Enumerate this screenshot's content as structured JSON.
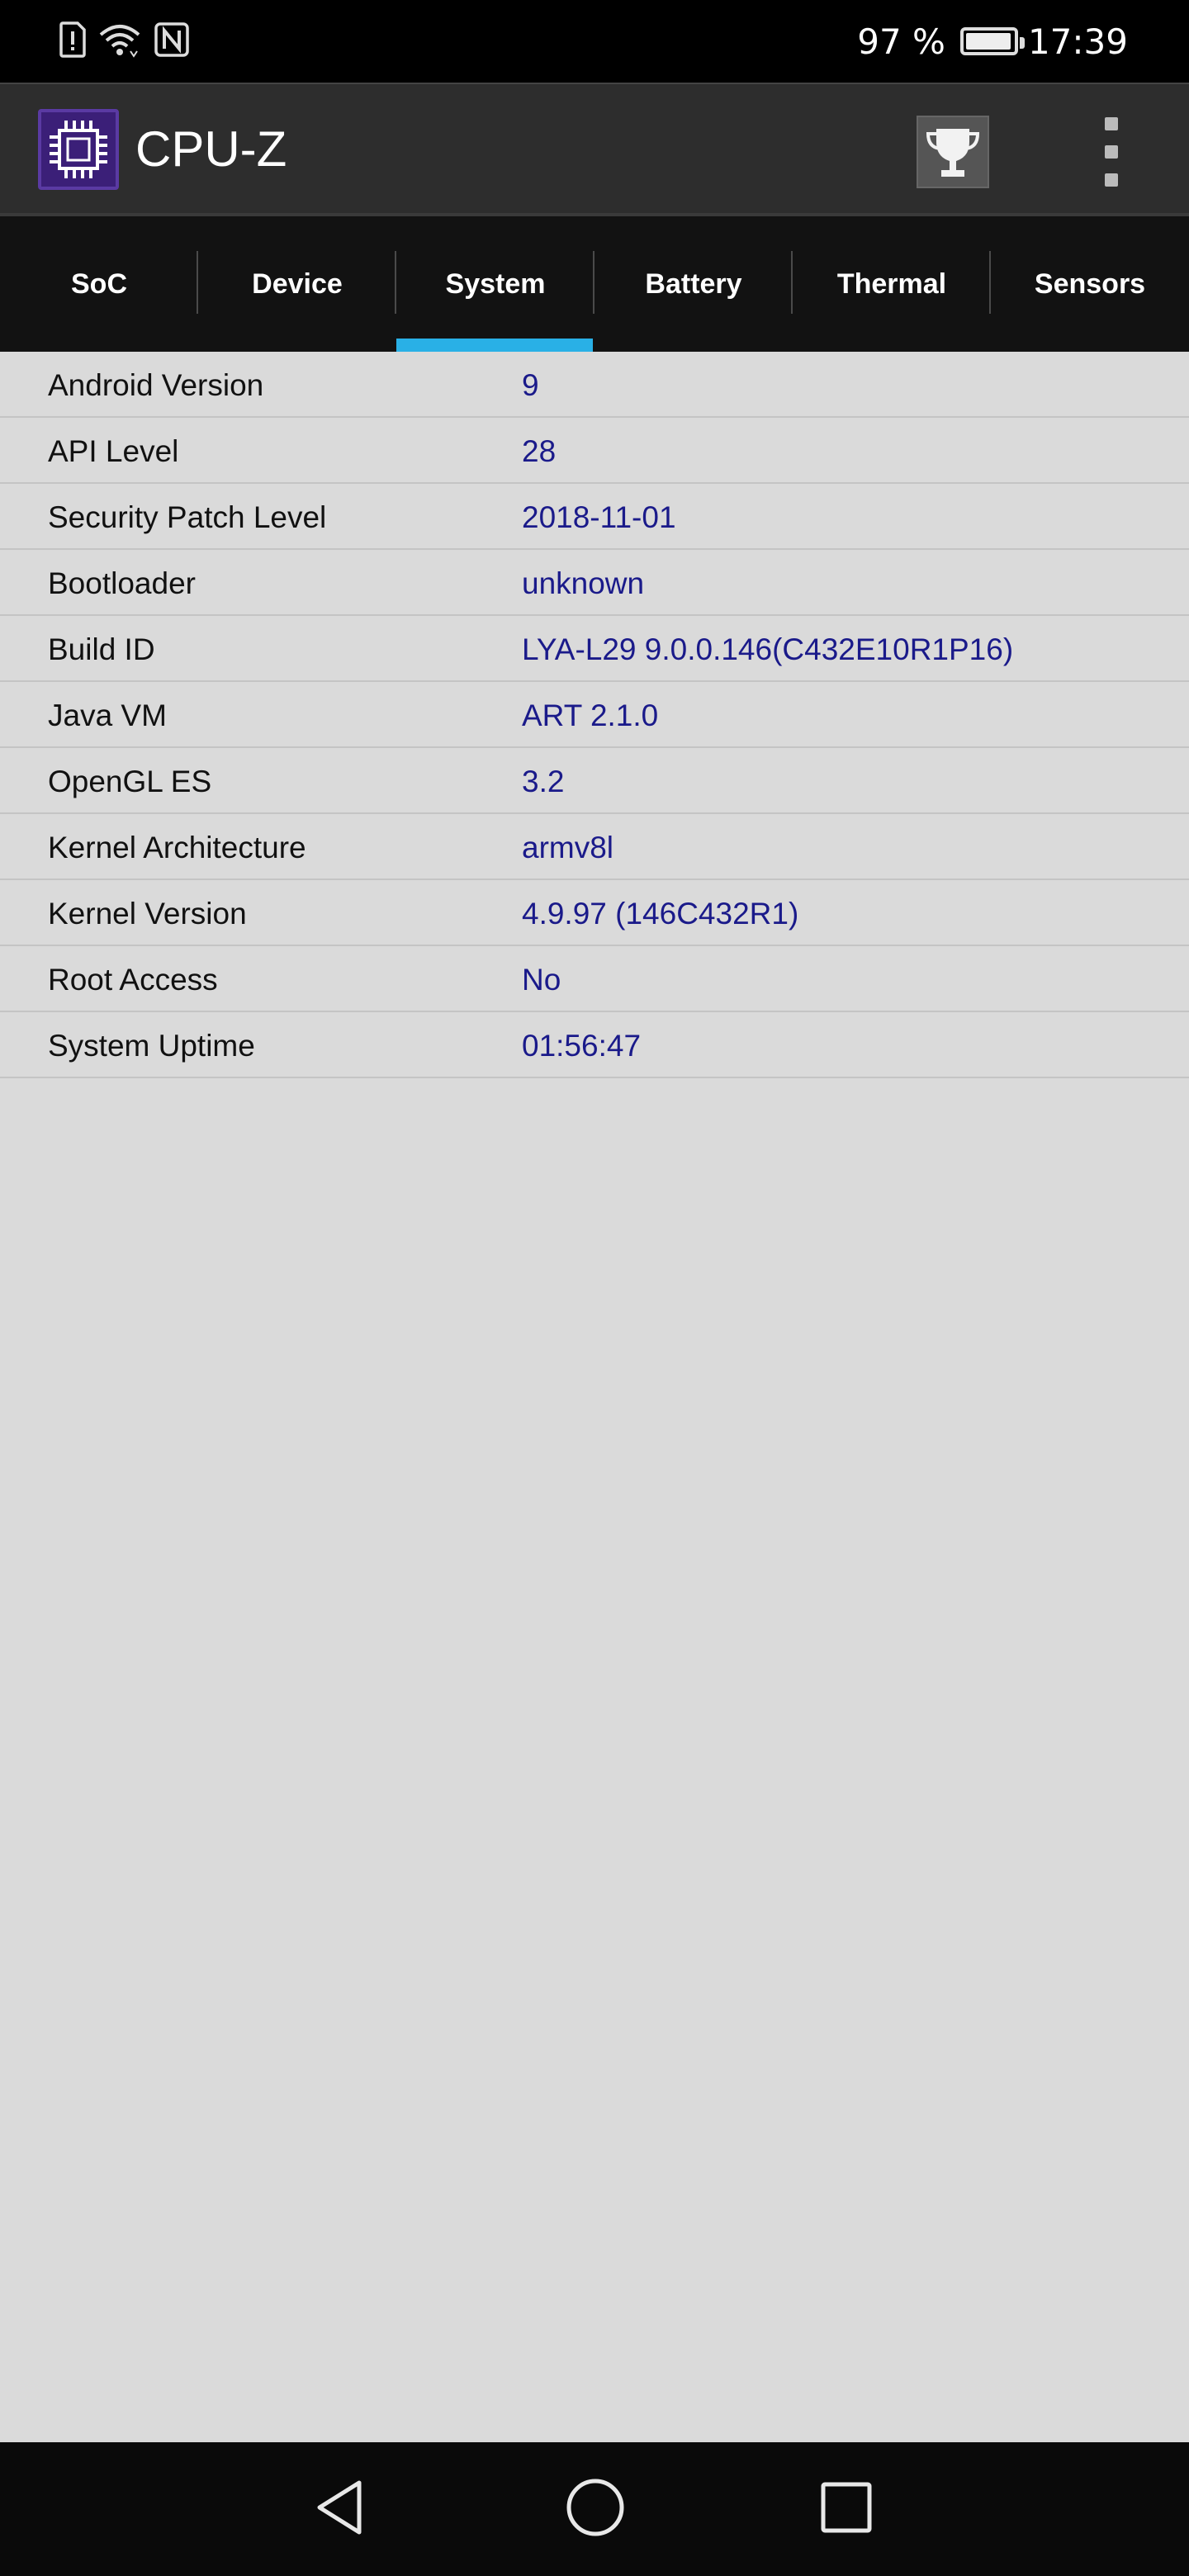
{
  "status_bar": {
    "battery_percent": "97 %",
    "battery_level": 0.97,
    "time": "17:39",
    "icons": [
      "sim-alert-icon",
      "wifi-icon",
      "nfc-icon",
      "battery-icon"
    ]
  },
  "app_bar": {
    "title": "CPU-Z",
    "logo_icon": "cpu-chip-icon",
    "actions": [
      "trophy-icon",
      "overflow-menu-icon"
    ]
  },
  "tabs": [
    {
      "label": "SoC",
      "active": false
    },
    {
      "label": "Device",
      "active": false
    },
    {
      "label": "System",
      "active": true
    },
    {
      "label": "Battery",
      "active": false
    },
    {
      "label": "Thermal",
      "active": false
    },
    {
      "label": "Sensors",
      "active": false
    }
  ],
  "system_info": [
    {
      "label": "Android Version",
      "value": "9"
    },
    {
      "label": "API Level",
      "value": "28"
    },
    {
      "label": "Security Patch Level",
      "value": "2018-11-01"
    },
    {
      "label": "Bootloader",
      "value": "unknown"
    },
    {
      "label": "Build ID",
      "value": "LYA-L29 9.0.0.146(C432E10R1P16)"
    },
    {
      "label": "Java VM",
      "value": "ART 2.1.0"
    },
    {
      "label": "OpenGL ES",
      "value": "3.2"
    },
    {
      "label": "Kernel Architecture",
      "value": "armv8l"
    },
    {
      "label": "Kernel Version",
      "value": "4.9.97 (146C432R1)"
    },
    {
      "label": "Root Access",
      "value": "No"
    },
    {
      "label": "System Uptime",
      "value": "01:56:47"
    }
  ],
  "nav_bar": {
    "buttons": [
      "back-icon",
      "home-icon",
      "recents-icon"
    ]
  },
  "colors": {
    "accent": "#29b0e6",
    "value_text": "#1a1a8a",
    "background": "#dadada",
    "toolbar": "#2d2d2d",
    "tabbar": "#121212"
  }
}
